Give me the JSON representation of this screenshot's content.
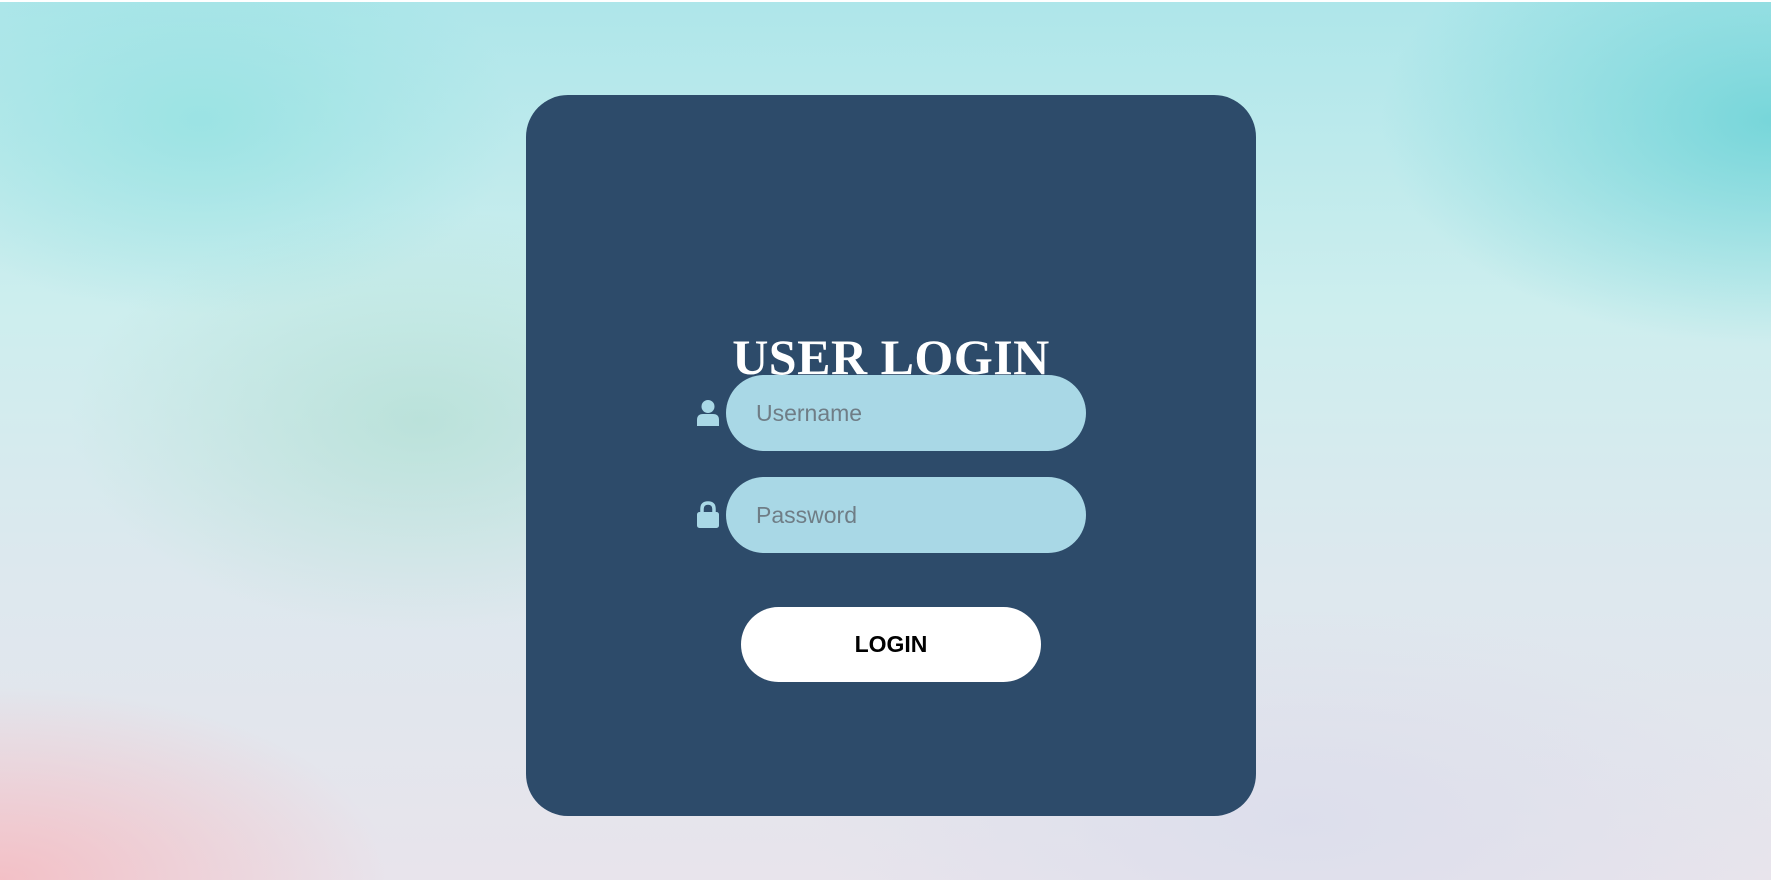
{
  "colors": {
    "card_background": "#2d4b6a",
    "input_background": "#a9d8e6",
    "icon_color": "#a9d8e6",
    "button_background": "#ffffff",
    "title_color": "#ffffff"
  },
  "login_form": {
    "title": "USER LOGIN",
    "username": {
      "icon": "user-icon",
      "placeholder": "Username",
      "value": ""
    },
    "password": {
      "icon": "lock-icon",
      "placeholder": "Password",
      "value": ""
    },
    "submit_label": "LOGIN"
  }
}
